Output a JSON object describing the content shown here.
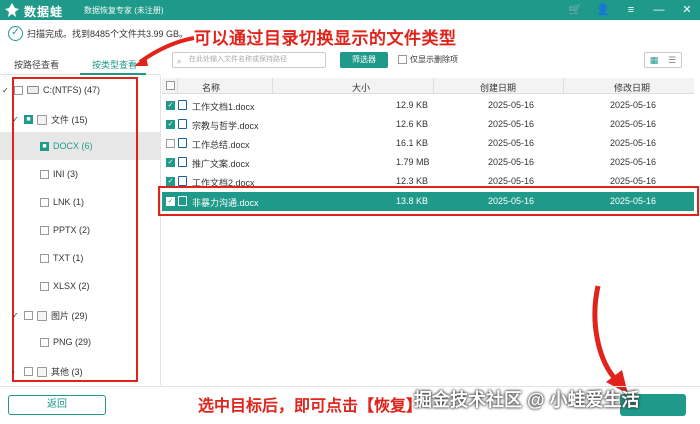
{
  "titlebar": {
    "brand": "数据蛙",
    "subtitle": "数据恢复专家 (未注册)"
  },
  "status": {
    "text": "扫描完成。找到8485个文件共3.99 GB。"
  },
  "annotations": {
    "top": "可以通过目录切换显示的文件类型",
    "bottom": "选中目标后，即可点击【恢复】",
    "watermark": "掘金技术社区 @ 小蛙爱生活"
  },
  "tabs": {
    "by_path": "按路径查看",
    "by_type": "按类型查看"
  },
  "toolbar": {
    "search_placeholder": "在此处输入文件名称或保持路径",
    "filter_label": "筛选器",
    "only_deleted_label": "仅显示删除项"
  },
  "tree": [
    {
      "label": "C:(NTFS) (47)"
    },
    {
      "label": "文件 (15)"
    },
    {
      "label": "DOCX (6)"
    },
    {
      "label": "INI (3)"
    },
    {
      "label": "LNK (1)"
    },
    {
      "label": "PPTX (2)"
    },
    {
      "label": "TXT (1)"
    },
    {
      "label": "XLSX (2)"
    },
    {
      "label": "图片 (29)"
    },
    {
      "label": "PNG (29)"
    },
    {
      "label": "其他 (3)"
    }
  ],
  "table": {
    "headers": {
      "name": "名称",
      "size": "大小",
      "created": "创建日期",
      "modified": "修改日期"
    },
    "rows": [
      {
        "name": "工作文档1.docx",
        "size": "12.9 KB",
        "created": "2025-05-16",
        "modified": "2025-05-16"
      },
      {
        "name": "宗教与哲学.docx",
        "size": "12.6 KB",
        "created": "2025-05-16",
        "modified": "2025-05-16"
      },
      {
        "name": "工作总结.docx",
        "size": "16.1 KB",
        "created": "2025-05-16",
        "modified": "2025-05-16"
      },
      {
        "name": "推广文案.docx",
        "size": "1.79 MB",
        "created": "2025-05-16",
        "modified": "2025-05-16"
      },
      {
        "name": "工作文档2.docx",
        "size": "12.3 KB",
        "created": "2025-05-16",
        "modified": "2025-05-16"
      },
      {
        "name": "非暴力沟通.docx",
        "size": "13.8 KB",
        "created": "2025-05-16",
        "modified": "2025-05-16"
      }
    ]
  },
  "buttons": {
    "back": "返回"
  },
  "colors": {
    "accent": "#1f9a8a",
    "annotation": "#e0241b"
  }
}
